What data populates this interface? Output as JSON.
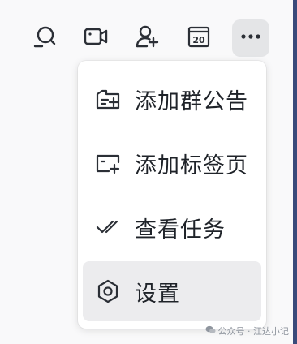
{
  "toolbar": {
    "icons": [
      "search-icon",
      "video-call-icon",
      "add-member-icon",
      "calendar-icon",
      "more-icon"
    ],
    "calendar_day": "20"
  },
  "menu": {
    "items": [
      {
        "label": "添加群公告",
        "icon": "group-announcement-icon"
      },
      {
        "label": "添加标签页",
        "icon": "add-tab-icon"
      },
      {
        "label": "查看任务",
        "icon": "task-check-icon"
      },
      {
        "label": "设置",
        "icon": "gear-icon"
      }
    ]
  },
  "watermark": {
    "text": "公众号 · 江达小记"
  },
  "colors": {
    "background": "#f9f9fa",
    "menu_bg": "#ffffff",
    "highlight": "#ececee",
    "icon": "#1f2329"
  }
}
